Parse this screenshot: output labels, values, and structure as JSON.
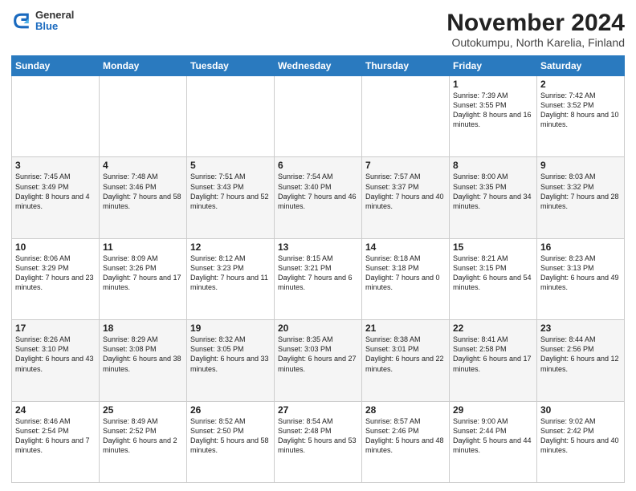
{
  "header": {
    "logo": {
      "line1": "General",
      "line2": "Blue"
    },
    "title": "November 2024",
    "subtitle": "Outokumpu, North Karelia, Finland"
  },
  "days_of_week": [
    "Sunday",
    "Monday",
    "Tuesday",
    "Wednesday",
    "Thursday",
    "Friday",
    "Saturday"
  ],
  "weeks": [
    [
      {
        "day": "",
        "info": ""
      },
      {
        "day": "",
        "info": ""
      },
      {
        "day": "",
        "info": ""
      },
      {
        "day": "",
        "info": ""
      },
      {
        "day": "",
        "info": ""
      },
      {
        "day": "1",
        "info": "Sunrise: 7:39 AM\nSunset: 3:55 PM\nDaylight: 8 hours and 16 minutes."
      },
      {
        "day": "2",
        "info": "Sunrise: 7:42 AM\nSunset: 3:52 PM\nDaylight: 8 hours and 10 minutes."
      }
    ],
    [
      {
        "day": "3",
        "info": "Sunrise: 7:45 AM\nSunset: 3:49 PM\nDaylight: 8 hours and 4 minutes."
      },
      {
        "day": "4",
        "info": "Sunrise: 7:48 AM\nSunset: 3:46 PM\nDaylight: 7 hours and 58 minutes."
      },
      {
        "day": "5",
        "info": "Sunrise: 7:51 AM\nSunset: 3:43 PM\nDaylight: 7 hours and 52 minutes."
      },
      {
        "day": "6",
        "info": "Sunrise: 7:54 AM\nSunset: 3:40 PM\nDaylight: 7 hours and 46 minutes."
      },
      {
        "day": "7",
        "info": "Sunrise: 7:57 AM\nSunset: 3:37 PM\nDaylight: 7 hours and 40 minutes."
      },
      {
        "day": "8",
        "info": "Sunrise: 8:00 AM\nSunset: 3:35 PM\nDaylight: 7 hours and 34 minutes."
      },
      {
        "day": "9",
        "info": "Sunrise: 8:03 AM\nSunset: 3:32 PM\nDaylight: 7 hours and 28 minutes."
      }
    ],
    [
      {
        "day": "10",
        "info": "Sunrise: 8:06 AM\nSunset: 3:29 PM\nDaylight: 7 hours and 23 minutes."
      },
      {
        "day": "11",
        "info": "Sunrise: 8:09 AM\nSunset: 3:26 PM\nDaylight: 7 hours and 17 minutes."
      },
      {
        "day": "12",
        "info": "Sunrise: 8:12 AM\nSunset: 3:23 PM\nDaylight: 7 hours and 11 minutes."
      },
      {
        "day": "13",
        "info": "Sunrise: 8:15 AM\nSunset: 3:21 PM\nDaylight: 7 hours and 6 minutes."
      },
      {
        "day": "14",
        "info": "Sunrise: 8:18 AM\nSunset: 3:18 PM\nDaylight: 7 hours and 0 minutes."
      },
      {
        "day": "15",
        "info": "Sunrise: 8:21 AM\nSunset: 3:15 PM\nDaylight: 6 hours and 54 minutes."
      },
      {
        "day": "16",
        "info": "Sunrise: 8:23 AM\nSunset: 3:13 PM\nDaylight: 6 hours and 49 minutes."
      }
    ],
    [
      {
        "day": "17",
        "info": "Sunrise: 8:26 AM\nSunset: 3:10 PM\nDaylight: 6 hours and 43 minutes."
      },
      {
        "day": "18",
        "info": "Sunrise: 8:29 AM\nSunset: 3:08 PM\nDaylight: 6 hours and 38 minutes."
      },
      {
        "day": "19",
        "info": "Sunrise: 8:32 AM\nSunset: 3:05 PM\nDaylight: 6 hours and 33 minutes."
      },
      {
        "day": "20",
        "info": "Sunrise: 8:35 AM\nSunset: 3:03 PM\nDaylight: 6 hours and 27 minutes."
      },
      {
        "day": "21",
        "info": "Sunrise: 8:38 AM\nSunset: 3:01 PM\nDaylight: 6 hours and 22 minutes."
      },
      {
        "day": "22",
        "info": "Sunrise: 8:41 AM\nSunset: 2:58 PM\nDaylight: 6 hours and 17 minutes."
      },
      {
        "day": "23",
        "info": "Sunrise: 8:44 AM\nSunset: 2:56 PM\nDaylight: 6 hours and 12 minutes."
      }
    ],
    [
      {
        "day": "24",
        "info": "Sunrise: 8:46 AM\nSunset: 2:54 PM\nDaylight: 6 hours and 7 minutes."
      },
      {
        "day": "25",
        "info": "Sunrise: 8:49 AM\nSunset: 2:52 PM\nDaylight: 6 hours and 2 minutes."
      },
      {
        "day": "26",
        "info": "Sunrise: 8:52 AM\nSunset: 2:50 PM\nDaylight: 5 hours and 58 minutes."
      },
      {
        "day": "27",
        "info": "Sunrise: 8:54 AM\nSunset: 2:48 PM\nDaylight: 5 hours and 53 minutes."
      },
      {
        "day": "28",
        "info": "Sunrise: 8:57 AM\nSunset: 2:46 PM\nDaylight: 5 hours and 48 minutes."
      },
      {
        "day": "29",
        "info": "Sunrise: 9:00 AM\nSunset: 2:44 PM\nDaylight: 5 hours and 44 minutes."
      },
      {
        "day": "30",
        "info": "Sunrise: 9:02 AM\nSunset: 2:42 PM\nDaylight: 5 hours and 40 minutes."
      }
    ]
  ]
}
